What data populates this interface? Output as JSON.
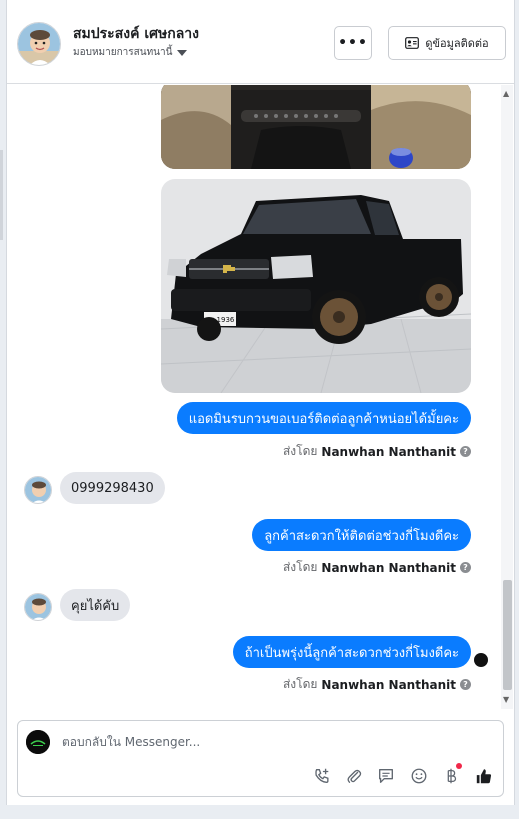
{
  "header": {
    "contact_name": "สมประสงค์ เศษกลาง",
    "assign_label": "มอบหมายการสนทนานี้",
    "more_label": "•••",
    "contact_info_label": "ดูข้อมูลติดต่อ"
  },
  "messages": {
    "out_1": "แอดมินรบกวนขอเบอร์ติดต่อลูกค้าหน่อยได้มั้ยคะ",
    "in_1": "0999298430",
    "out_2": "ลูกค้าสะดวกให้ติดต่อช่วงกี่โมงดีคะ",
    "in_2": "คุยได้คับ",
    "out_3": "ถ้าเป็นพรุ่งนี้ลูกค้าสะดวกช่วงกี่โมงดีคะ"
  },
  "sent_by": {
    "prefix": "ส่งโดย",
    "name": "Nanwhan Nanthanit"
  },
  "car_plate": "ผพ 1936",
  "composer": {
    "placeholder": "ตอบกลับใน Messenger..."
  },
  "icons": [
    "info-icon",
    "phone-add-icon",
    "attachment-icon",
    "saved-reply-icon",
    "emoji-icon",
    "baht-icon",
    "like-icon"
  ],
  "colors": {
    "bubble_out": "#0a7cff",
    "bubble_in": "#e4e6eb",
    "like": "#1c1e21"
  }
}
